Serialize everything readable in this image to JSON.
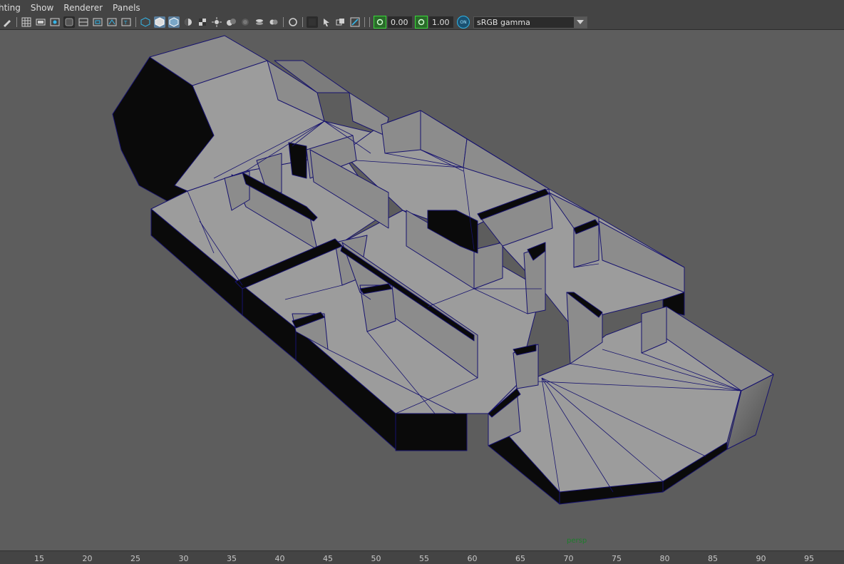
{
  "menu": [
    {
      "id": "lighting",
      "label": "hting"
    },
    {
      "id": "show",
      "label": "Show"
    },
    {
      "id": "renderer",
      "label": "Renderer"
    },
    {
      "id": "panels",
      "label": "Panels"
    }
  ],
  "toolbar": {
    "icons": [
      "pencil-icon",
      "grid-icon",
      "film-gate-icon",
      "resolution-gate-icon",
      "gate-mask-icon",
      "field-chart-icon",
      "safe-action-icon",
      "safe-title-icon",
      "wireframe-icon",
      "smooth-shade-icon",
      "default-material-icon",
      "wireframe-on-shaded-icon",
      "textured-icon",
      "use-all-lights-icon",
      "shadows-icon",
      "screen-space-ao-icon",
      "motion-blur-icon",
      "multisample-aa-icon",
      "depth-of-field-icon",
      "isolate-select-icon",
      "xray-icon",
      "xray-active-icon",
      "xray-joints-icon",
      "backface-culling-icon"
    ],
    "exposure_value": "0.00",
    "gamma_value": "1.00",
    "color_management_label": "ON",
    "view_transform": "sRGB gamma"
  },
  "viewport": {
    "camera_label": "persp",
    "colors": {
      "background": "#5d5d5d",
      "face_light": "#9c9c9c",
      "face_mid": "#8c8c8c",
      "face_dark": "#7a7a7a",
      "side_dark": "#0a0a0a",
      "wire": "#16126e",
      "camera_label": "#1e7d2c"
    }
  },
  "ruler": {
    "ticks": [
      "15",
      "20",
      "25",
      "30",
      "35",
      "40",
      "45",
      "50",
      "55",
      "60",
      "65",
      "70",
      "75",
      "80",
      "85",
      "90",
      "95"
    ]
  }
}
